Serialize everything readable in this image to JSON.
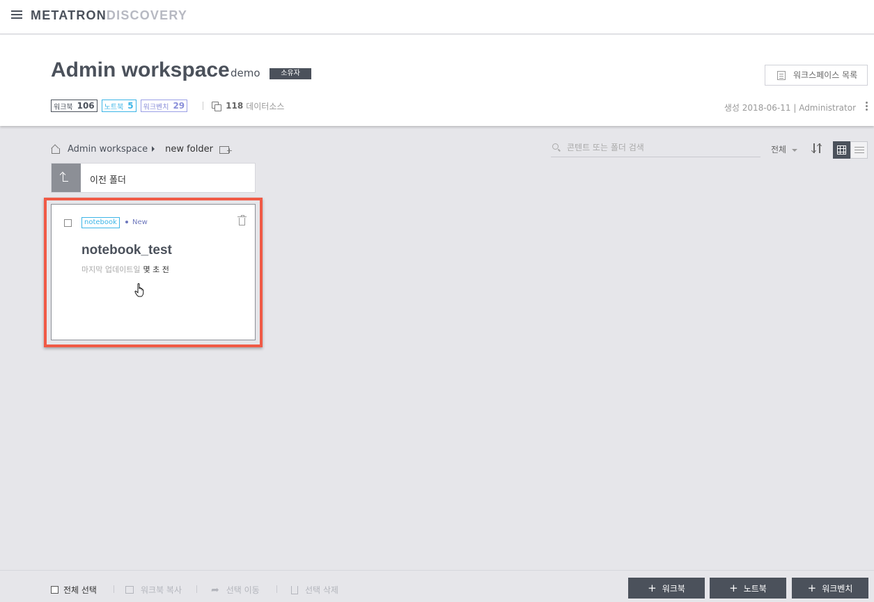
{
  "topbar": {
    "logo_primary": "METATRON",
    "logo_secondary": "DISCOVERY"
  },
  "workspace": {
    "title": "Admin workspace",
    "owner": "demo",
    "role": "소유자",
    "list_button": "워크스페이스 목록",
    "stats": {
      "workbook_label": "워크북",
      "workbook_count": "106",
      "notebook_label": "노트북",
      "notebook_count": "5",
      "workbench_label": "워크벤치",
      "workbench_count": "29",
      "datasource_count": "118",
      "datasource_label": "데이터소스"
    },
    "meta": "생성 2018-06-11 | Administrator"
  },
  "breadcrumb": {
    "root": "Admin workspace",
    "current": "new folder"
  },
  "tools": {
    "search_placeholder": "콘텐트 또는 폴더 검색",
    "filter": "전체"
  },
  "prev_folder": {
    "label": "이전 폴더"
  },
  "card": {
    "tag": "notebook",
    "new_label": "New",
    "name": "notebook_test",
    "updated_label": "마지막 업데이트일",
    "updated_value": "몇 초 전"
  },
  "bottombar": {
    "select_all": "전체 선택",
    "copy_workbook": "워크북 복사",
    "move_selected": "선택 이동",
    "delete_selected": "선택 삭제",
    "buttons": [
      {
        "label": "워크북"
      },
      {
        "label": "노트북"
      },
      {
        "label": "워크벤치"
      }
    ]
  },
  "colors": {
    "accent": "#4b515b",
    "notebook_tag": "#3cb5e7",
    "highlight": "#f05a46"
  }
}
